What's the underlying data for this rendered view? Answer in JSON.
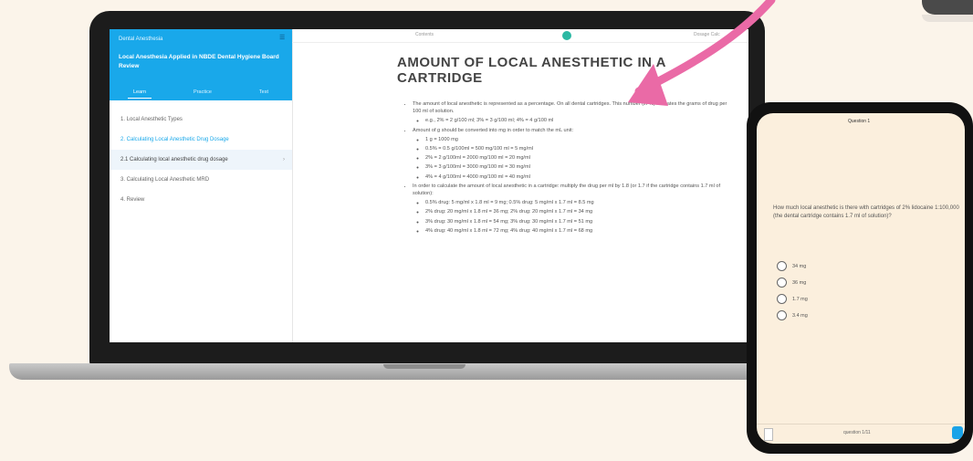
{
  "colors": {
    "accent": "#19a8ea",
    "arrow": "#ea6aa6",
    "page_bg": "#fbf4ea",
    "phone_bg": "#fbefdd"
  },
  "laptop": {
    "sidebar": {
      "top_label": "Dental Anesthesia",
      "course_title": "Local Anesthesia Applied in NBDE Dental Hygiene Board Review",
      "tabs": [
        "Learn",
        "Practice",
        "Test"
      ],
      "items": [
        "1. Local Anesthetic Types",
        "2. Calculating Local Anesthetic Drug Dosage",
        "2.1 Calculating local anesthetic drug dosage",
        "3. Calculating Local Anesthetic MRD",
        "4. Review"
      ]
    },
    "topbar": {
      "left": "Contents",
      "right": "Dosage Calc"
    },
    "heading": "AMOUNT OF LOCAL ANESTHETIC IN A CARTRIDGE",
    "paragraphs": [
      "The amount of local anesthetic is represented as a percentage. On all dental cartridges. This number (in %) indicates the grams of drug per 100 ml of solution.",
      "e.g., 2% = 2 g/100 ml; 3% = 3 g/100 ml; 4% = 4 g/100 ml",
      "Amount of g should be converted into mg in order to match the mL unit:",
      "1 g = 1000 mg",
      "0.5% = 0.5 g/100ml = 500 mg/100 ml = 5 mg/ml",
      "2% = 2 g/100ml = 2000 mg/100 ml = 20 mg/ml",
      "3% = 3 g/100ml = 3000 mg/100 ml = 30 mg/ml",
      "4% = 4 g/100ml = 4000 mg/100 ml = 40 mg/ml",
      "In order to calculate the amount of local anesthetic in a cartridge: multiply the drug per ml by 1.8 (or 1.7 if the cartridge contains 1.7 ml of solution):",
      "0.5% drug: 5 mg/ml x 1.8 ml = 9 mg; 0.5% drug: 5 mg/ml x 1.7 ml = 8.5 mg",
      "2% drug: 20 mg/ml x 1.8 ml = 36 mg; 2% drug: 20 mg/ml x 1.7 ml = 34 mg",
      "3% drug: 30 mg/ml x 1.8 ml = 54 mg; 3% drug: 30 mg/ml x 1.7 ml = 51 mg",
      "4% drug: 40 mg/ml x 1.8 ml = 72 mg; 4% drug: 40 mg/ml x 1.7 ml = 68 mg"
    ]
  },
  "phone": {
    "status": "Question 1",
    "question": "How much local anesthetic is there with cartridges of 2% lidocaine 1:100,000 (the dental cartridge contains 1.7 ml of solution)?",
    "options": [
      "34 mg",
      "36 mg",
      "1.7 mg",
      "3.4 mg"
    ],
    "footer": "question 1/11"
  }
}
